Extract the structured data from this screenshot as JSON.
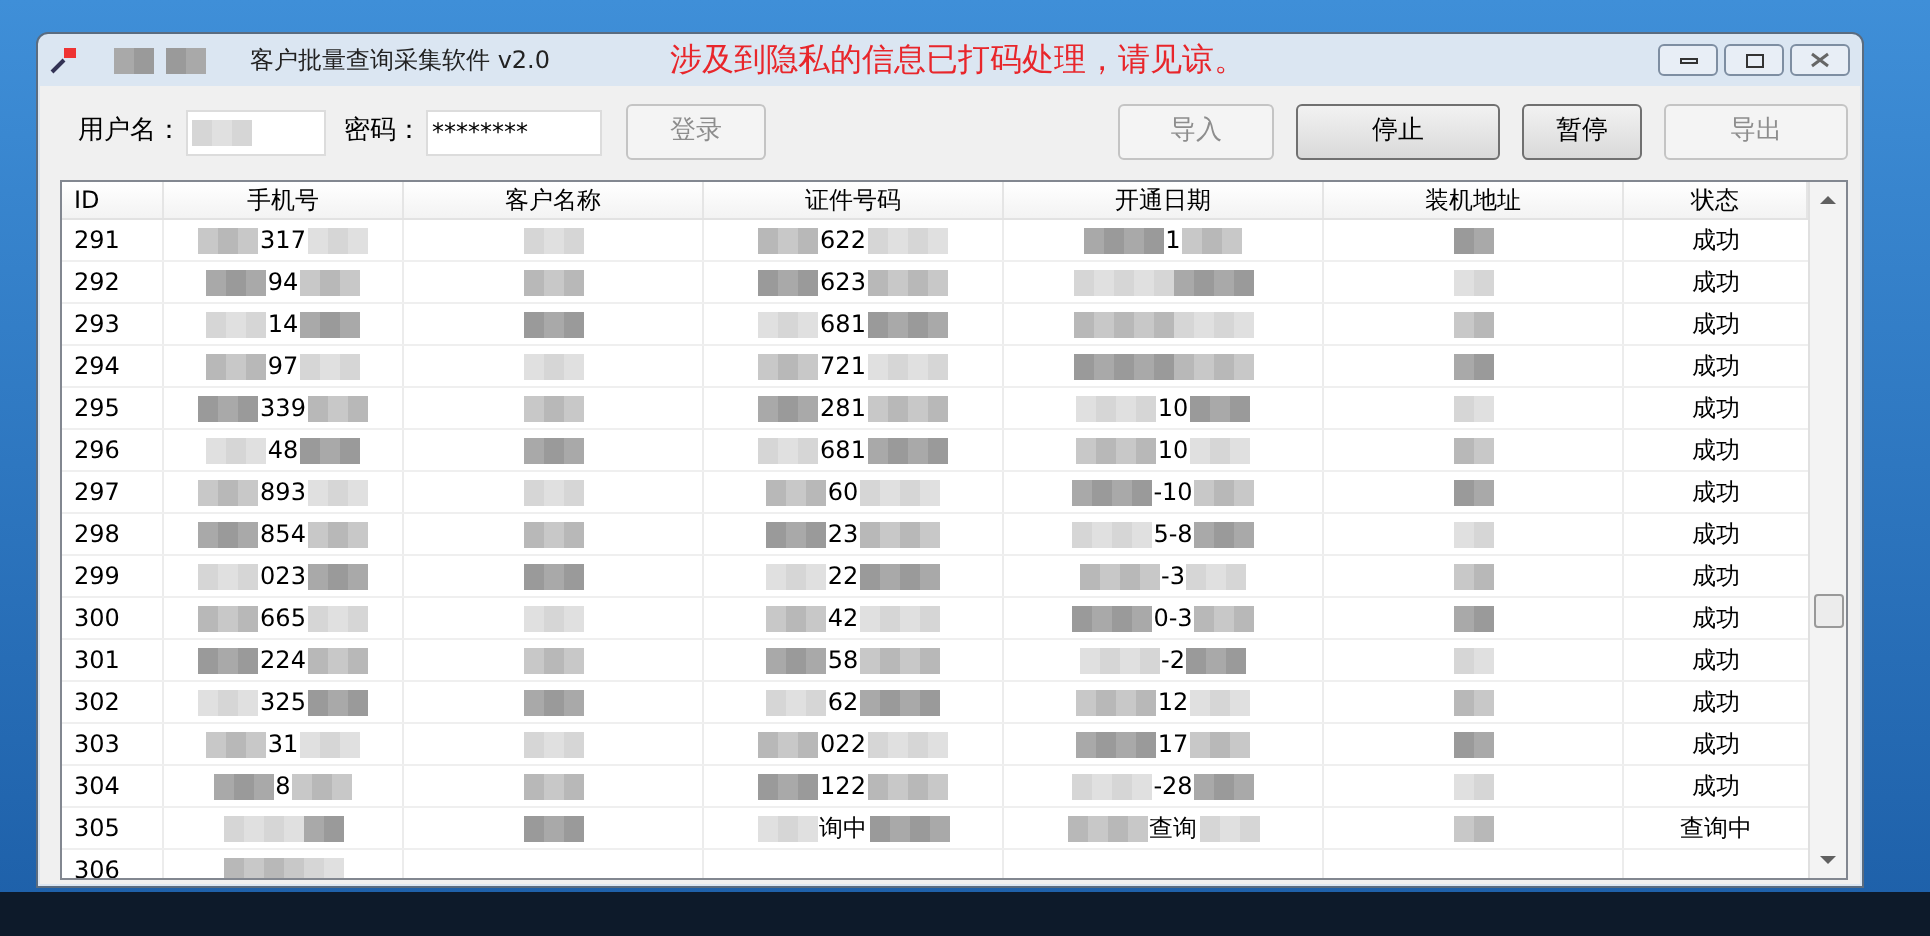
{
  "window": {
    "title": "客户批量查询采集软件 v2.0",
    "notice": "涉及到隐私的信息已打码处理，请见谅。"
  },
  "login": {
    "username_label": "用户名：",
    "password_label": "密码：",
    "password": "********",
    "button": {
      "label": "登录",
      "disabled": true
    }
  },
  "actions": [
    {
      "label": "导入",
      "disabled": true
    },
    {
      "label": "停止",
      "disabled": false
    },
    {
      "label": "暂停",
      "disabled": false
    },
    {
      "label": "导出",
      "disabled": true
    }
  ],
  "table": {
    "columns": [
      "ID",
      "手机号",
      "客户名称",
      "证件号码",
      "开通日期",
      "装机地址",
      "状态"
    ],
    "rows": [
      {
        "id": "291",
        "phone": "317",
        "cert": "622",
        "date": "1",
        "status": "成功"
      },
      {
        "id": "292",
        "phone": "94",
        "cert": "623",
        "status": "成功"
      },
      {
        "id": "293",
        "phone": "14",
        "cert": "681",
        "status": "成功"
      },
      {
        "id": "294",
        "phone": "97",
        "cert": "721",
        "status": "成功"
      },
      {
        "id": "295",
        "phone": "339",
        "cert": "281",
        "date": "10",
        "status": "成功"
      },
      {
        "id": "296",
        "phone": "48",
        "cert": "681",
        "date": "10",
        "status": "成功"
      },
      {
        "id": "297",
        "phone": "893",
        "cert": "60",
        "date": "-10",
        "status": "成功"
      },
      {
        "id": "298",
        "phone": "854",
        "cert": "23",
        "date": "5-8",
        "status": "成功"
      },
      {
        "id": "299",
        "phone": "023",
        "cert": "22",
        "date": "-3",
        "status": "成功"
      },
      {
        "id": "300",
        "phone": "665",
        "cert": "42",
        "date": "0-3",
        "status": "成功"
      },
      {
        "id": "301",
        "phone": "224",
        "cert": "58",
        "date": "-2",
        "status": "成功"
      },
      {
        "id": "302",
        "phone": "325",
        "cert": "62",
        "date": "12",
        "status": "成功"
      },
      {
        "id": "303",
        "phone": "31",
        "cert": "022",
        "date": "17",
        "status": "成功"
      },
      {
        "id": "304",
        "phone": "8",
        "cert": "122",
        "date": "-28",
        "status": "成功"
      },
      {
        "id": "305",
        "cert": "询中",
        "date": "查询",
        "status": "查询中"
      },
      {
        "id": "306"
      }
    ]
  }
}
